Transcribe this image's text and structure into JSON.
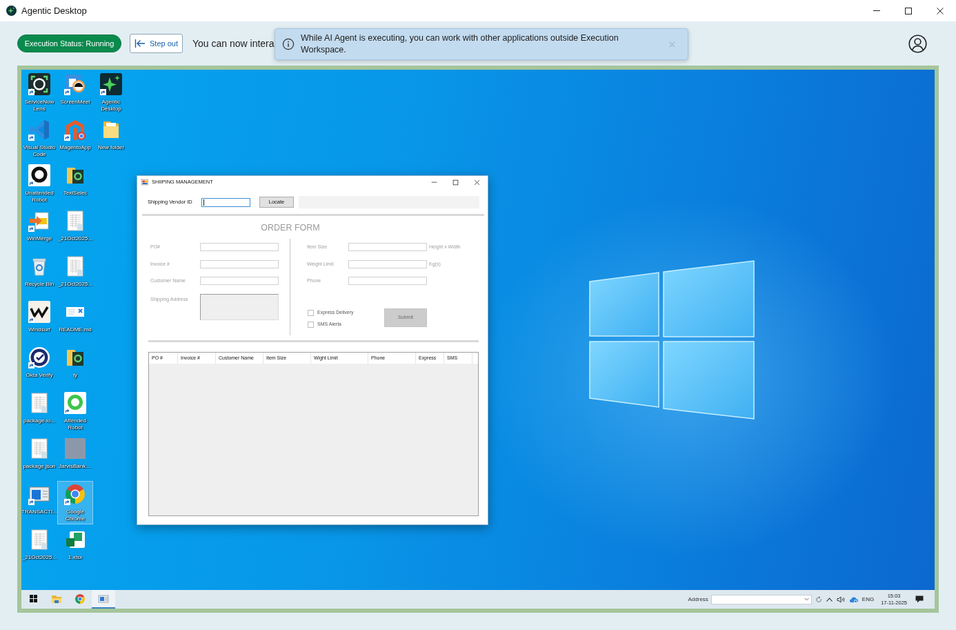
{
  "window": {
    "title": "Agentic Desktop"
  },
  "toolbar": {
    "status": "Execution Status: Running",
    "step_out": "Step out",
    "message": "You can now intera"
  },
  "toast": {
    "text": "While AI Agent is executing, you can work with other applications outside Execution Workspace."
  },
  "desktop_icons": [
    {
      "label": "ServiceNow Lens",
      "shortcut": true,
      "selected": false
    },
    {
      "label": "ScreenMeet",
      "shortcut": true,
      "selected": false
    },
    {
      "label": "Agentic Desktop",
      "shortcut": true,
      "selected": false
    },
    {
      "label": "Visual Studio Code",
      "shortcut": true,
      "selected": false
    },
    {
      "label": "MagentoApp",
      "shortcut": true,
      "selected": false
    },
    {
      "label": "New folder",
      "shortcut": false,
      "selected": false
    },
    {
      "label": "Unattended Robot",
      "shortcut": true,
      "selected": false
    },
    {
      "label": "TextSelec",
      "shortcut": false,
      "selected": false
    },
    {
      "label": "WinMerge",
      "shortcut": true,
      "selected": false
    },
    {
      "label": "_21Oct2025...",
      "shortcut": false,
      "selected": false
    },
    {
      "label": "Recycle Bin",
      "shortcut": false,
      "selected": false
    },
    {
      "label": "_21Oct2025...",
      "shortcut": false,
      "selected": false
    },
    {
      "label": "Windsurf",
      "shortcut": true,
      "selected": false
    },
    {
      "label": "README.md",
      "shortcut": false,
      "selected": false
    },
    {
      "label": "Okta Verify",
      "shortcut": true,
      "selected": false
    },
    {
      "label": "ty",
      "shortcut": false,
      "selected": false
    },
    {
      "label": "package-lo...",
      "shortcut": false,
      "selected": false
    },
    {
      "label": "Attended Robot",
      "shortcut": true,
      "selected": false
    },
    {
      "label": "package.json",
      "shortcut": false,
      "selected": false
    },
    {
      "label": "JarvisBank....",
      "shortcut": false,
      "selected": false
    },
    {
      "label": "TRANSACTI...",
      "shortcut": true,
      "selected": false
    },
    {
      "label": "Google Chrome",
      "shortcut": true,
      "selected": true
    },
    {
      "label": "_21Oct2025...",
      "shortcut": false,
      "selected": false
    },
    {
      "label": "1.xlsx",
      "shortcut": false,
      "selected": false
    }
  ],
  "app_window": {
    "title": "SHIIPING MANAGEMENT",
    "vendor_label": "Shipping Vendor ID",
    "vendor_field": {
      "focused": true
    },
    "locate_button": "Locate",
    "form": {
      "title": "ORDER FORM",
      "disabled": true,
      "left_fields": [
        {
          "label": "PO#",
          "kind": "line"
        },
        {
          "label": "Invoice #",
          "kind": "line"
        },
        {
          "label": "Customer Name",
          "kind": "line"
        },
        {
          "label": "Shipping Address",
          "kind": "area"
        }
      ],
      "right_fields": [
        {
          "label": "Item Size",
          "unit": "Height x Width"
        },
        {
          "label": "Weight Limit",
          "unit": "Kg(s)"
        },
        {
          "label": "Phone"
        }
      ],
      "options": [
        {
          "label": "Express Delivery",
          "checked": false
        },
        {
          "label": "SMS Alerta",
          "checked": false
        }
      ],
      "submit": "Submit"
    },
    "table": {
      "columns": [
        "PO #",
        "Invoice #",
        "Customer Name",
        "Item Size",
        "Wight Limit",
        "Phone",
        "Express",
        "SMS"
      ]
    }
  },
  "taskbar": {
    "apps": [
      {
        "selected": false
      },
      {
        "selected": false
      },
      {
        "selected": true
      }
    ],
    "address_label": "Address",
    "language": "ENG",
    "time": "15:03",
    "date": "17-11-2025"
  }
}
